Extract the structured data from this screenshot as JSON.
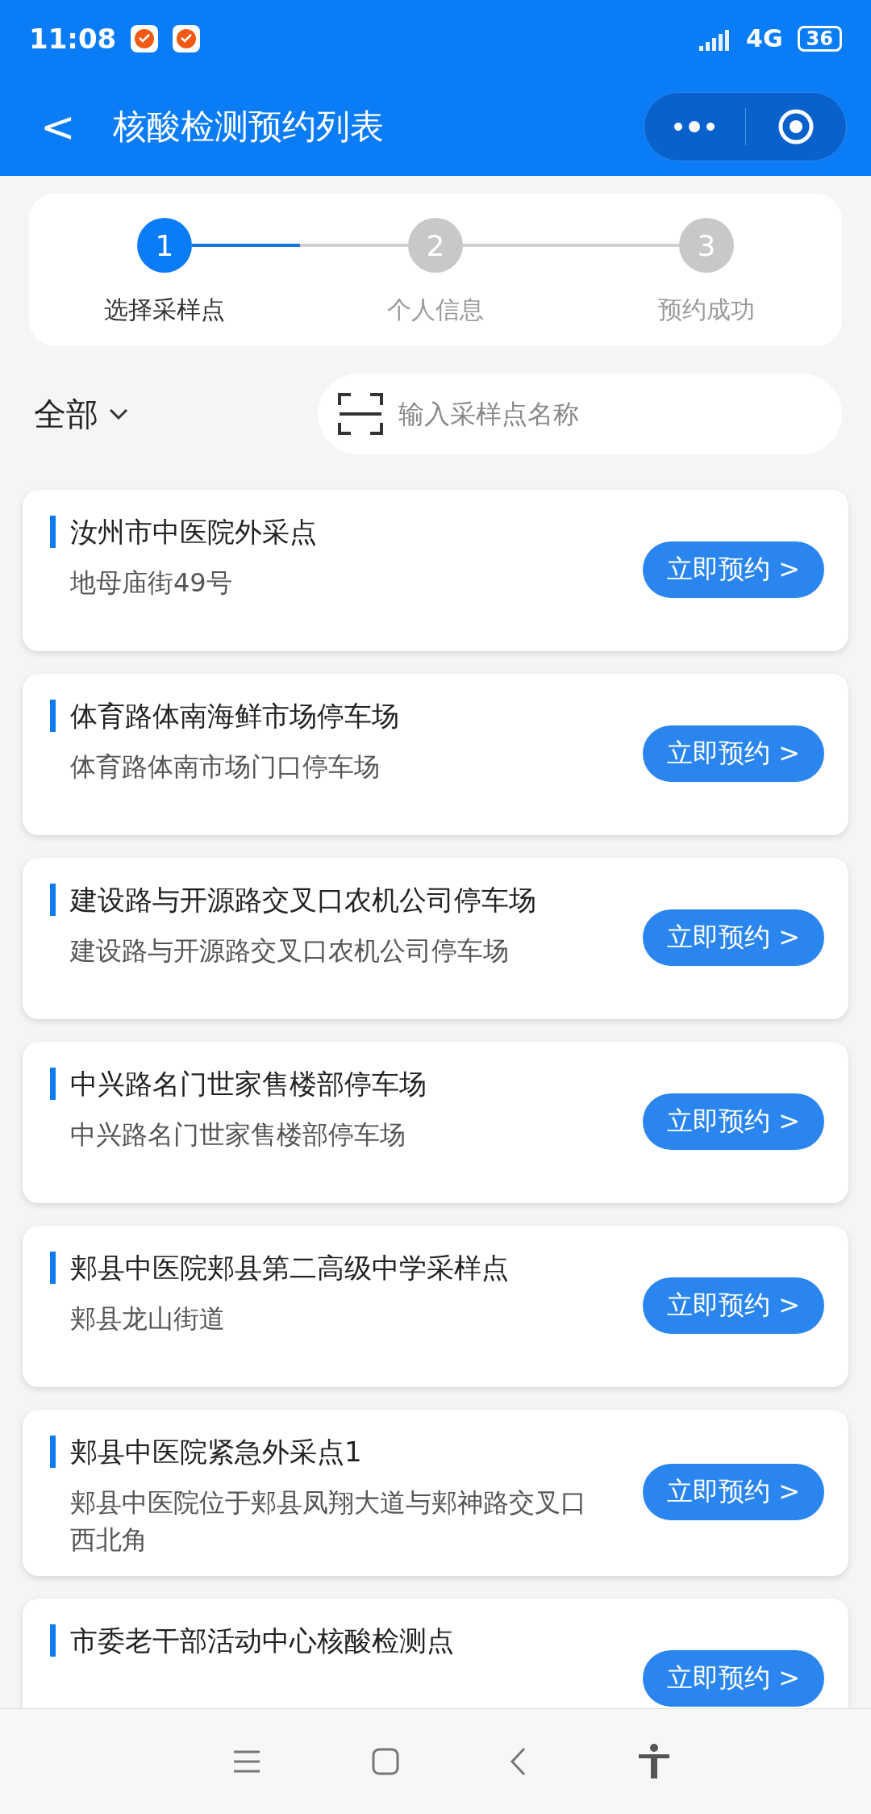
{
  "status_bar": {
    "time": "11:08",
    "network": "4G",
    "battery": "36"
  },
  "header": {
    "back": "<",
    "title": "核酸检测预约列表"
  },
  "steps": {
    "items": [
      {
        "number": "1",
        "label": "选择采样点",
        "selected": true,
        "level": 0.5
      },
      {
        "number": "2",
        "label": "个人信息",
        "selected": false
      },
      {
        "number": "3",
        "label": "预约成功",
        "selected": false
      }
    ]
  },
  "filter": {
    "label": "全部",
    "placeholder": "输入采样点名称"
  },
  "sites": [
    {
      "name": "汝州市中医院外采点",
      "address": "地母庙街49号",
      "button": "立即预约 >"
    },
    {
      "name": "体育路体南海鲜市场停车场",
      "address": "体育路体南市场门口停车场",
      "button": "立即预约 >"
    },
    {
      "name": "建设路与开源路交叉口农机公司停车场",
      "address": "建设路与开源路交叉口农机公司停车场",
      "button": "立即预约 >"
    },
    {
      "name": "中兴路名门世家售楼部停车场",
      "address": "中兴路名门世家售楼部停车场",
      "button": "立即预约 >"
    },
    {
      "name": "郏县中医院郏县第二高级中学采样点",
      "address": "郏县龙山街道",
      "button": "立即预约 >"
    },
    {
      "name": "郏县中医院紧急外采点1",
      "address": "郏县中医院位于郏县凤翔大道与郏神路交叉口西北角",
      "button": "立即预约 >"
    },
    {
      "name": "市委老干部活动中心核酸检测点",
      "button": "立即预约 >"
    }
  ]
}
